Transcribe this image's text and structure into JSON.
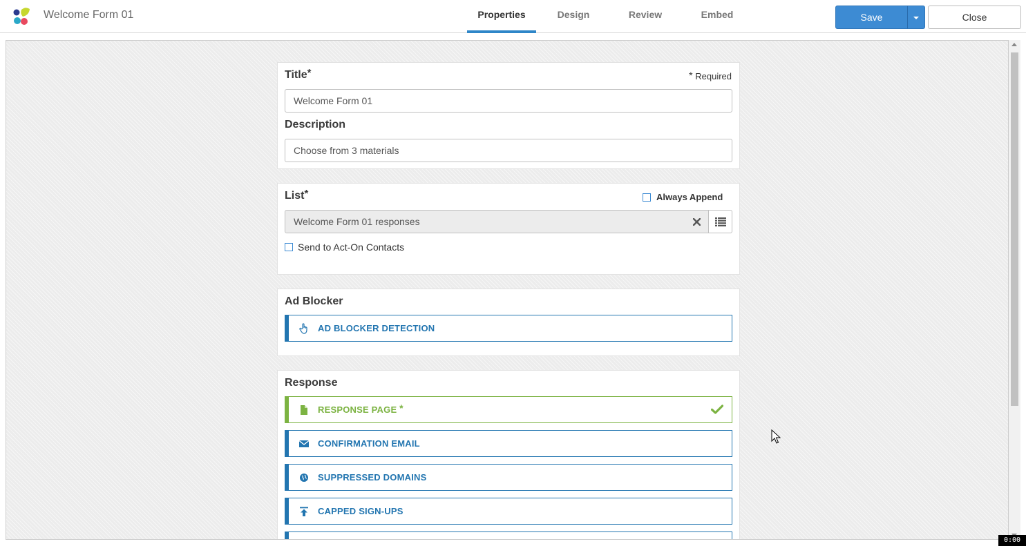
{
  "header": {
    "form_title": "Welcome Form 01",
    "tabs": [
      {
        "label": "Properties",
        "active": true
      },
      {
        "label": "Design",
        "active": false
      },
      {
        "label": "Review",
        "active": false
      },
      {
        "label": "Embed",
        "active": false
      }
    ],
    "save_label": "Save",
    "close_label": "Close"
  },
  "title_section": {
    "label": "Title",
    "required_marker": "*",
    "required_note": "Required",
    "title_value": "Welcome Form 01",
    "description_label": "Description",
    "description_value": "Choose from 3 materials"
  },
  "list_section": {
    "label": "List",
    "always_append_label": "Always Append",
    "list_value": "Welcome Form 01 responses",
    "send_to_contacts_label": "Send to Act-On Contacts"
  },
  "ad_blocker_section": {
    "label": "Ad Blocker",
    "items": [
      {
        "label": "AD BLOCKER DETECTION",
        "icon": "hand-pointer-icon"
      }
    ]
  },
  "response_section": {
    "label": "Response",
    "items": [
      {
        "label": "RESPONSE PAGE",
        "icon": "file-icon",
        "required": true,
        "complete": true
      },
      {
        "label": "CONFIRMATION EMAIL",
        "icon": "envelope-icon"
      },
      {
        "label": "SUPPRESSED DOMAINS",
        "icon": "globe-icon"
      },
      {
        "label": "CAPPED SIGN-UPS",
        "icon": "upload-arrow-icon"
      }
    ]
  },
  "timer": "0:00",
  "colors": {
    "accent_blue": "#2275b0",
    "save_blue": "#3d8bd3",
    "complete_green": "#7cb342",
    "tab_underline": "#2e86c8"
  }
}
